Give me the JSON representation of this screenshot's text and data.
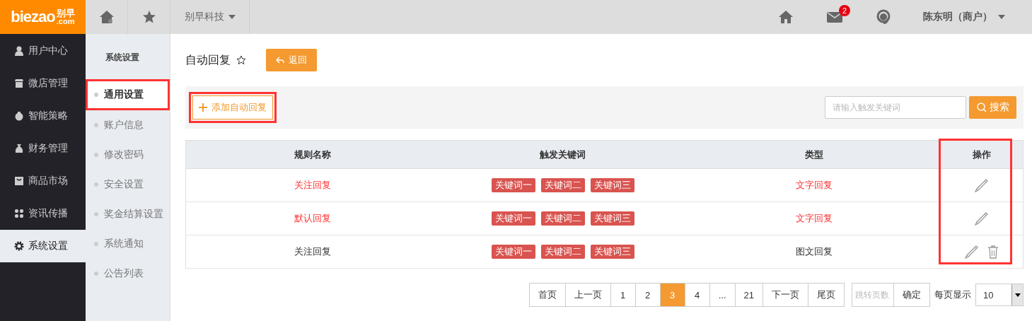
{
  "header": {
    "logo_text": "biezao",
    "logo_cn": "别早",
    "logo_domain": ".com",
    "company": "别早科技",
    "mail_count": "2",
    "user": "陈东明（商户）"
  },
  "sidebar": {
    "items": [
      {
        "label": "用户中心",
        "selected": false
      },
      {
        "label": "微店管理",
        "selected": false
      },
      {
        "label": "智能策略",
        "selected": false
      },
      {
        "label": "财务管理",
        "selected": false
      },
      {
        "label": "商品市场",
        "selected": false
      },
      {
        "label": "资讯传播",
        "selected": false
      },
      {
        "label": "系统设置",
        "selected": true
      }
    ]
  },
  "submenu": {
    "title": "系统设置",
    "items": [
      {
        "label": "通用设置",
        "selected": true,
        "annotated": true
      },
      {
        "label": "账户信息",
        "selected": false,
        "annotated": false
      },
      {
        "label": "修改密码",
        "selected": false,
        "annotated": false
      },
      {
        "label": "安全设置",
        "selected": false,
        "annotated": false
      },
      {
        "label": "奖金结算设置",
        "selected": false,
        "annotated": false
      },
      {
        "label": "系统通知",
        "selected": false,
        "annotated": false
      },
      {
        "label": "公告列表",
        "selected": false,
        "annotated": false
      }
    ]
  },
  "page": {
    "title": "自动回复",
    "back_button": "返回"
  },
  "toolbar": {
    "add_button": {
      "label": "添加自动回复",
      "annotated": true
    },
    "search": {
      "placeholder": "请输入触发关键词"
    },
    "search_button": "搜索"
  },
  "table": {
    "columns": [
      {
        "label": "规则名称",
        "annotated": false
      },
      {
        "label": "触发关键词",
        "annotated": false
      },
      {
        "label": "类型",
        "annotated": false
      },
      {
        "label": "操作",
        "annotated": true
      }
    ],
    "rows": [
      {
        "name": "关注回复",
        "highlighted": true,
        "keywords": [
          "关键词一",
          "关键词二",
          "关键词三"
        ],
        "type": "文字回复",
        "deletable": false
      },
      {
        "name": "默认回复",
        "highlighted": true,
        "keywords": [
          "关键词一",
          "关键词二",
          "关键词三"
        ],
        "type": "文字回复",
        "deletable": false
      },
      {
        "name": "关注回复",
        "highlighted": false,
        "keywords": [
          "关键词一",
          "关键词二",
          "关键词三"
        ],
        "type": "图文回复",
        "deletable": true
      }
    ]
  },
  "pagination": {
    "pages": [
      {
        "label": "首页",
        "selected": false
      },
      {
        "label": "上一页",
        "selected": false
      },
      {
        "label": "1",
        "selected": false
      },
      {
        "label": "2",
        "selected": false
      },
      {
        "label": "3",
        "selected": true
      },
      {
        "label": "4",
        "selected": false
      },
      {
        "label": "...",
        "selected": false
      },
      {
        "label": "21",
        "selected": false
      },
      {
        "label": "下一页",
        "selected": false
      },
      {
        "label": "尾页",
        "selected": false
      }
    ],
    "jump_placeholder": "跳转页数",
    "confirm": "确定",
    "per_page_label": "每页显示",
    "per_page": "10"
  }
}
